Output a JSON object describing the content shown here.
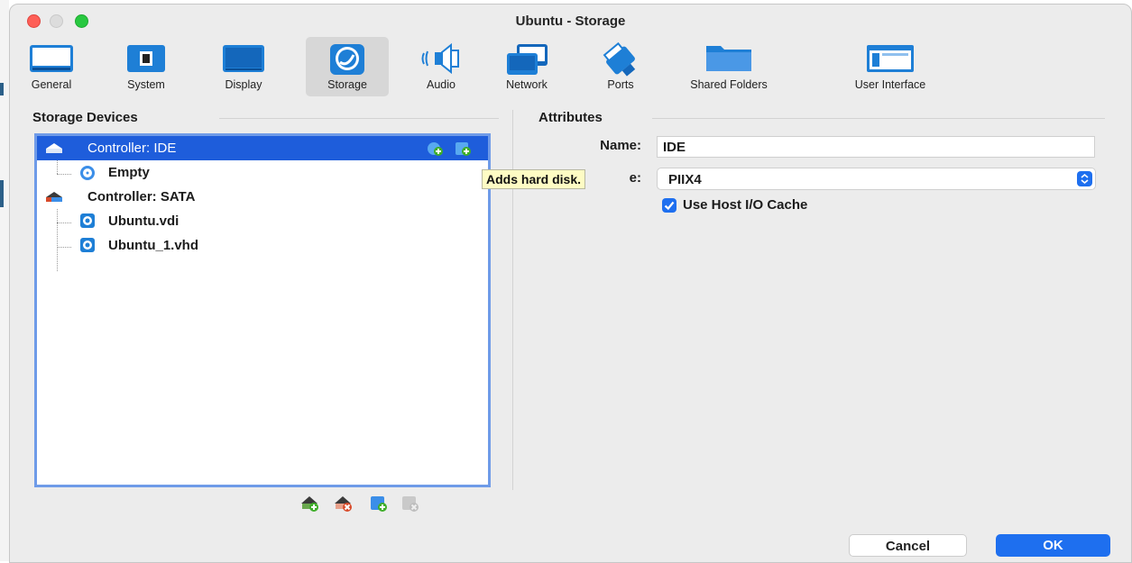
{
  "window": {
    "title": "Ubuntu - Storage"
  },
  "toolbar": {
    "items": [
      {
        "label": "General",
        "icon": "general-icon"
      },
      {
        "label": "System",
        "icon": "system-chip-icon"
      },
      {
        "label": "Display",
        "icon": "display-monitor-icon"
      },
      {
        "label": "Storage",
        "icon": "storage-disk-icon",
        "selected": true
      },
      {
        "label": "Audio",
        "icon": "speaker-icon"
      },
      {
        "label": "Network",
        "icon": "network-icon"
      },
      {
        "label": "Ports",
        "icon": "ports-plug-icon"
      },
      {
        "label": "Shared Folders",
        "icon": "folder-icon"
      },
      {
        "label": "User Interface",
        "icon": "user-interface-window-icon"
      }
    ]
  },
  "storage_devices": {
    "label": "Storage Devices",
    "tree": [
      {
        "label": "Controller: IDE",
        "type": "controller",
        "selected": true
      },
      {
        "label": "Empty",
        "type": "optical"
      },
      {
        "label": "Controller: SATA",
        "type": "controller"
      },
      {
        "label": "Ubuntu.vdi",
        "type": "disk"
      },
      {
        "label": "Ubuntu_1.vhd",
        "type": "disk"
      }
    ],
    "tooltip": "Adds hard disk."
  },
  "attributes": {
    "label": "Attributes",
    "name_label": "Name:",
    "name_value": "IDE",
    "type_label": "e:",
    "type_value": "PIIX4",
    "host_cache_label": "Use Host I/O Cache",
    "host_cache_checked": true
  },
  "buttons": {
    "cancel": "Cancel",
    "ok": "OK"
  },
  "colors": {
    "accent": "#1e6fef",
    "selection": "#1e5ddb",
    "tooltip_bg": "#fefcc4"
  }
}
